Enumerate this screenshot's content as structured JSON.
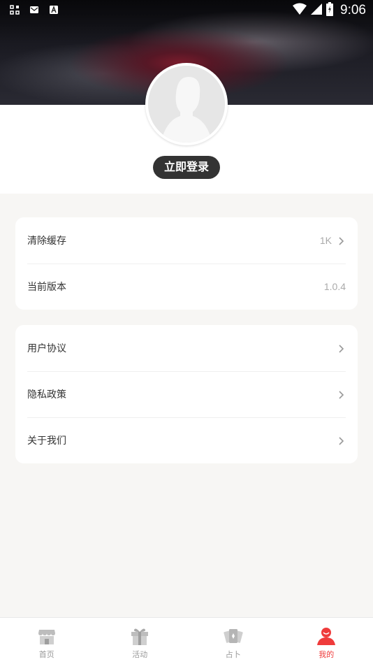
{
  "status_bar": {
    "time": "9:06",
    "left_icons": [
      "apps-grid-icon",
      "mail-icon",
      "font-a-icon"
    ],
    "right_icons": [
      "wifi-icon",
      "cell-signal-icon",
      "battery-charging-icon"
    ]
  },
  "profile": {
    "avatar_icon": "default-user-avatar-icon",
    "login_label": "立即登录"
  },
  "settings_group": [
    {
      "label": "清除缓存",
      "value": "1K",
      "has_arrow": true
    },
    {
      "label": "当前版本",
      "value": "1.0.4",
      "has_arrow": false
    }
  ],
  "info_group": [
    {
      "label": "用户协议",
      "has_arrow": true
    },
    {
      "label": "隐私政策",
      "has_arrow": true
    },
    {
      "label": "关于我们",
      "has_arrow": true
    }
  ],
  "tabbar": {
    "items": [
      {
        "label": "首页",
        "icon": "home-icon",
        "active": false
      },
      {
        "label": "活动",
        "icon": "gift-icon",
        "active": false
      },
      {
        "label": "占卜",
        "icon": "tarot-cards-icon",
        "active": false
      },
      {
        "label": "我的",
        "icon": "user-icon",
        "active": true
      }
    ]
  },
  "colors": {
    "accent": "#ef3b3b",
    "login_button_bg": "#333333",
    "page_bg": "#f7f6f4"
  }
}
